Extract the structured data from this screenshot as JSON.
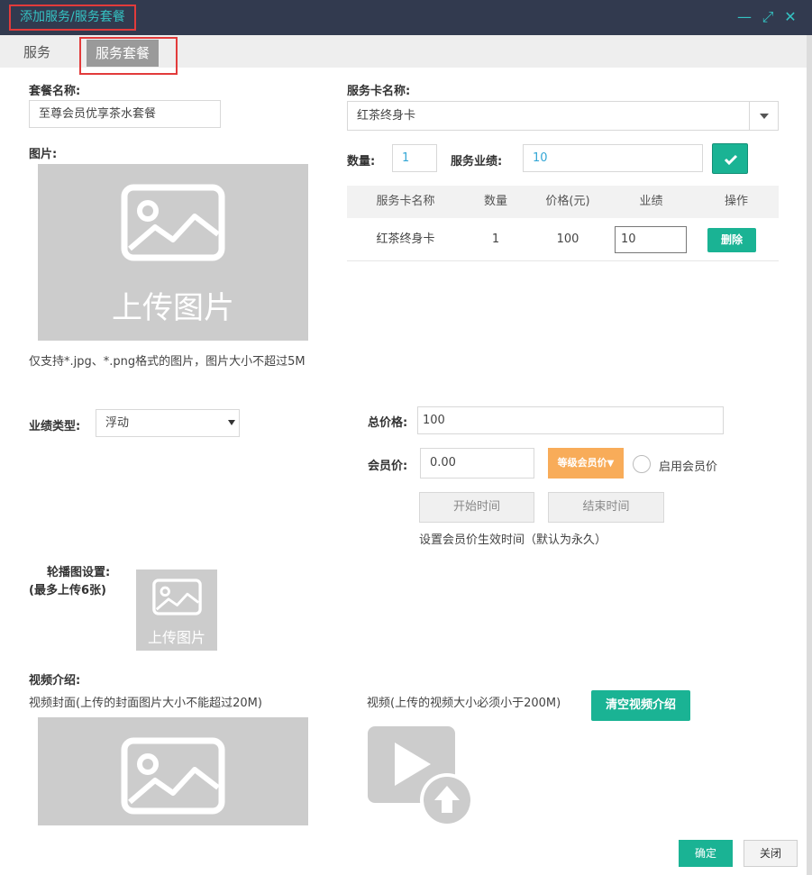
{
  "window": {
    "title": "添加服务/服务套餐",
    "minimize_glyph": "—",
    "maximize_glyph": "⤢",
    "close_glyph": "✕"
  },
  "tabs": [
    {
      "label": "服务"
    },
    {
      "label": "服务套餐"
    }
  ],
  "form": {
    "package_name_label": "套餐名称:",
    "package_name_value": "至尊会员优享茶水套餐",
    "image_label": "图片:",
    "upload_text": "上传图片",
    "image_hint": "仅支持*.jpg、*.png格式的图片，图片大小不超过5M",
    "card_name_label": "服务卡名称:",
    "card_name_value": "红茶终身卡",
    "quantity_label": "数量:",
    "quantity_value": "1",
    "performance_label": "服务业绩:",
    "performance_value": "10",
    "perf_type_label": "业绩类型:",
    "perf_type_value": "浮动",
    "total_price_label": "总价格:",
    "total_price_value": "100",
    "member_price_label": "会员价:",
    "member_price_value": "0.00",
    "level_member_price_btn": "等级会员价",
    "enable_member_price_label": "启用会员价",
    "start_time_placeholder": "开始时间",
    "end_time_placeholder": "结束时间",
    "member_price_hint": "设置会员价生效时间（默认为永久）",
    "carousel_label_line1": "轮播图设置:",
    "carousel_label_line2": "(最多上传6张)",
    "video_intro_label": "视频介绍:",
    "video_cover_label": "视频封面(上传的封面图片大小不能超过20M)",
    "video_label": "视频(上传的视频大小必须小于200M)",
    "clear_video_btn": "清空视频介绍"
  },
  "table": {
    "headers": [
      "服务卡名称",
      "数量",
      "价格(元)",
      "业绩",
      "操作"
    ],
    "rows": [
      {
        "name": "红茶终身卡",
        "qty": "1",
        "price": "100",
        "perf": "10",
        "action": "删除"
      }
    ]
  },
  "footer": {
    "confirm": "确定",
    "close": "关闭"
  },
  "icons": {
    "dropdown": "caret-down-icon",
    "select": "triangle-down-icon",
    "confirm_add": "check-icon",
    "image_placeholder": "image-icon",
    "video_placeholder": "video-upload-icon"
  },
  "colors": {
    "titlebar_bg": "#323a4f",
    "accent_teal": "#1ab394",
    "title_text": "#34c3c3",
    "highlight_red": "#e23b3b",
    "orange": "#f8ac59",
    "placeholder_grey": "#cccccc"
  }
}
